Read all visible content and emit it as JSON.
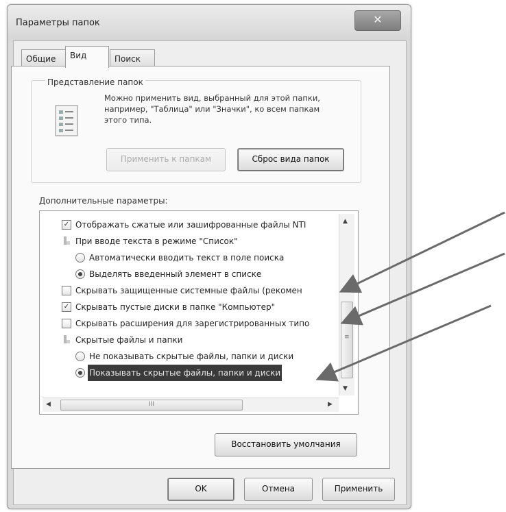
{
  "window": {
    "title": "Параметры папок",
    "close_glyph": "✕"
  },
  "tabs": [
    {
      "label": "Общие"
    },
    {
      "label": "Вид"
    },
    {
      "label": "Поиск"
    }
  ],
  "folder_view": {
    "group_label": "Представление папок",
    "description": "Можно применить вид, выбранный для этой папки, например, \"Таблица\" или \"Значки\", ко всем папкам этого типа.",
    "apply_button": "Применить к папкам",
    "reset_button": "Сброс вида папок"
  },
  "advanced": {
    "label": "Дополнительные параметры:",
    "items": [
      {
        "text": "Отображать сжатые или зашифрованные файлы NTI",
        "control": "checkbox",
        "checked": true
      },
      {
        "text": "При вводе текста в режиме \"Список\"",
        "control": "folder"
      },
      {
        "text": "Автоматически вводить текст в поле поиска",
        "control": "radio",
        "checked": false
      },
      {
        "text": "Выделять введенный элемент в списке",
        "control": "radio",
        "checked": true
      },
      {
        "text": "Скрывать защищенные системные файлы (рекомен",
        "control": "checkbox",
        "checked": false
      },
      {
        "text": "Скрывать пустые диски в папке \"Компьютер\"",
        "control": "checkbox",
        "checked": true
      },
      {
        "text": "Скрывать расширения для зарегистрированных типо",
        "control": "checkbox",
        "checked": false
      },
      {
        "text": "Скрытые файлы и папки",
        "control": "folder"
      },
      {
        "text": "Не показывать скрытые файлы, папки и диски",
        "control": "radio",
        "checked": false
      },
      {
        "text": "Показывать скрытые файлы, папки и диски",
        "control": "radio",
        "checked": true,
        "selected": true
      }
    ],
    "hscroll_grip": "III",
    "vscroll_grip": "≡"
  },
  "restore_button": "Восстановить умолчания",
  "footer": {
    "ok": "OK",
    "cancel": "Отмена",
    "apply": "Применить"
  },
  "check_glyph": "✓"
}
